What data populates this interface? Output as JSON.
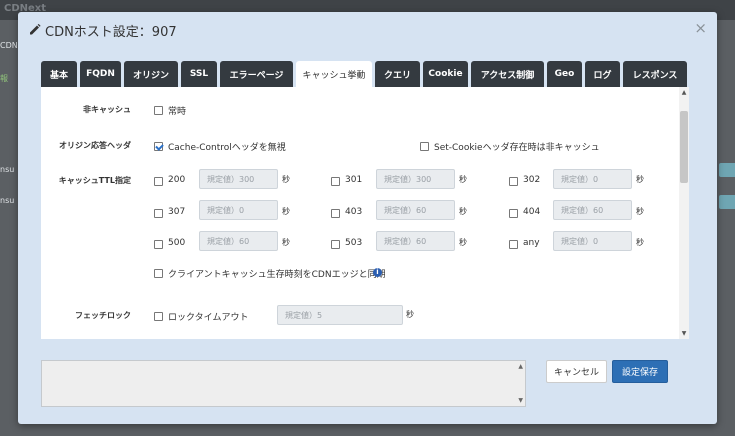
{
  "background": {
    "top_text": "CDNext",
    "side_texts": [
      "CDNホ",
      "報",
      "nsu",
      "nsu"
    ]
  },
  "modal": {
    "title": "CDNホスト設定：907",
    "close_glyph": "×"
  },
  "tabs": [
    {
      "label": "基本"
    },
    {
      "label": "FQDN"
    },
    {
      "label": "オリジン"
    },
    {
      "label": "SSL"
    },
    {
      "label": "エラーページ"
    },
    {
      "label": "キャッシュ挙動",
      "active": true
    },
    {
      "label": "クエリ"
    },
    {
      "label": "Cookie"
    },
    {
      "label": "アクセス制御"
    },
    {
      "label": "Geo"
    },
    {
      "label": "ログ"
    },
    {
      "label": "レスポンス"
    }
  ],
  "form": {
    "no_cache": {
      "label": "非キャッシュ",
      "option": "常時",
      "checked": false
    },
    "origin_header": {
      "label": "オリジン応答ヘッダ",
      "ignore_cache_control": {
        "text": "Cache-Controlヘッダを無視",
        "checked": true
      },
      "set_cookie_no_cache": {
        "text": "Set-Cookieヘッダ存在時は非キャッシュ",
        "checked": false
      }
    },
    "ttl": {
      "label": "キャッシュTTL指定",
      "unit": "秒",
      "codes": [
        {
          "code": "200",
          "placeholder": "規定値）300"
        },
        {
          "code": "301",
          "placeholder": "規定値）300"
        },
        {
          "code": "302",
          "placeholder": "規定値）0"
        },
        {
          "code": "307",
          "placeholder": "規定値）0"
        },
        {
          "code": "403",
          "placeholder": "規定値）60"
        },
        {
          "code": "404",
          "placeholder": "規定値）60"
        },
        {
          "code": "500",
          "placeholder": "規定値）60"
        },
        {
          "code": "503",
          "placeholder": "規定値）60"
        },
        {
          "code": "any",
          "placeholder": "規定値）0"
        }
      ],
      "sync_client": {
        "text": "クライアントキャッシュ生存時刻をCDNエッジと同期",
        "checked": false
      }
    },
    "fetch_lock": {
      "label": "フェッチロック",
      "option": "ロックタイムアウト",
      "placeholder": "規定値）5",
      "unit": "秒"
    }
  },
  "buttons": {
    "cancel": "キャンセル",
    "save": "設定保存"
  },
  "colors": {
    "tab_dark": "#343a40",
    "save_button": "#2d6fb5",
    "modal_bg": "#d6e3f2",
    "info_icon": "#2a5db0"
  },
  "icons": {
    "title": "pencil-icon",
    "close": "close-icon",
    "info": "info-icon"
  }
}
